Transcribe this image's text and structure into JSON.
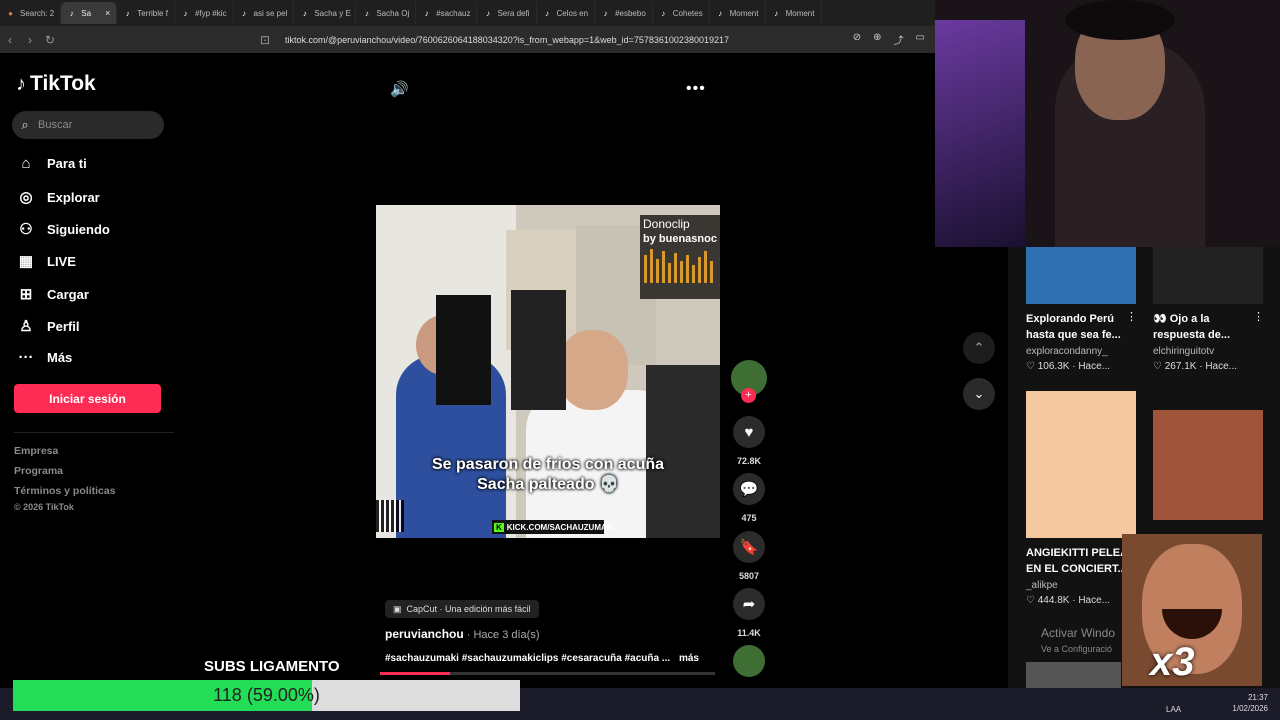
{
  "browser": {
    "tabs": [
      {
        "label": "Search: 2",
        "icon": "search-tab-icon",
        "active": false
      },
      {
        "label": "Sa",
        "icon": "tiktok-icon",
        "active": true
      },
      {
        "label": "Terrible f",
        "icon": "tiktok-icon",
        "active": false
      },
      {
        "label": "#fyp #kic",
        "icon": "tiktok-icon",
        "active": false
      },
      {
        "label": "asi se pel",
        "icon": "tiktok-icon",
        "active": false
      },
      {
        "label": "Sacha y E",
        "icon": "tiktok-icon",
        "active": false
      },
      {
        "label": "Sacha Oj",
        "icon": "tiktok-icon",
        "active": false
      },
      {
        "label": "#sachauz",
        "icon": "tiktok-icon",
        "active": false
      },
      {
        "label": "Sera defi",
        "icon": "tiktok-icon",
        "active": false
      },
      {
        "label": "Celos en",
        "icon": "tiktok-icon",
        "active": false
      },
      {
        "label": "#esbebo",
        "icon": "tiktok-icon",
        "active": false
      },
      {
        "label": "Cohetes",
        "icon": "tiktok-icon",
        "active": false
      },
      {
        "label": "Moment",
        "icon": "tiktok-icon",
        "active": false
      },
      {
        "label": "Moment",
        "icon": "tiktok-icon",
        "active": false
      }
    ],
    "url": "tiktok.com/@peruvianchou/video/7600626064188034320?is_from_webapp=1&web_id=7578361002380019217"
  },
  "sidebar": {
    "logo": "TikTok",
    "search_placeholder": "Buscar",
    "nav": [
      {
        "label": "Para ti",
        "icon": "home-icon"
      },
      {
        "label": "Explorar",
        "icon": "compass-icon"
      },
      {
        "label": "Siguiendo",
        "icon": "following-icon"
      },
      {
        "label": "LIVE",
        "icon": "live-icon"
      },
      {
        "label": "Cargar",
        "icon": "upload-icon"
      },
      {
        "label": "Perfil",
        "icon": "profile-icon"
      },
      {
        "label": "Más",
        "icon": "more-icon"
      }
    ],
    "login": "Iniciar sesión",
    "footer": [
      "Empresa",
      "Programa",
      "Términos y políticas"
    ],
    "copyright": "© 2026 TikTok"
  },
  "video": {
    "caption_line1": "Se pasaron de frios con acuña",
    "caption_line2": "Sacha palteado 💀",
    "watermark_title": "Donoclip",
    "watermark_by": "by buenasnoc",
    "kick_text": "KICK.COM/SACHAUZUMAKI",
    "actions": {
      "likes": "72.8K",
      "comments": "475",
      "saves": "5807",
      "shares": "11.4K"
    },
    "capcut": "CapCut · Una edición más fácil",
    "author": "peruvianchou",
    "time": " · Hace 3 día(s)",
    "hashtags": "#sachauzumaki #sachauzumakiclips #cesaracuña #acuña ...",
    "more_label": "más",
    "progress": 0.21
  },
  "feed": {
    "cards": [
      {
        "title": "Explorando Perú hasta que sea fe...",
        "user": "exploracondanny_",
        "stats": "♡ 106.3K · Hace..."
      },
      {
        "title": "👀 Ojo a la respuesta de...",
        "user": "elchiringuitotv",
        "stats": "♡ 267.1K · Hace..."
      },
      {
        "title": "ANGIEKITTI PELEA EN EL CONCIERT...",
        "user": "_alikpe",
        "stats": "♡ 444.8K · Hace..."
      }
    ],
    "activate_title": "Activar Windo",
    "activate_sub": "Ve a Configuració"
  },
  "overlay": {
    "subs_title": "SUBS LIGAMENTO",
    "subs_text": "118 (59.00%)",
    "subs_progress": 0.59,
    "meme_text": "x3"
  },
  "taskbar": {
    "time": "21:37",
    "date": "1/02/2026",
    "lang": "LAA"
  }
}
